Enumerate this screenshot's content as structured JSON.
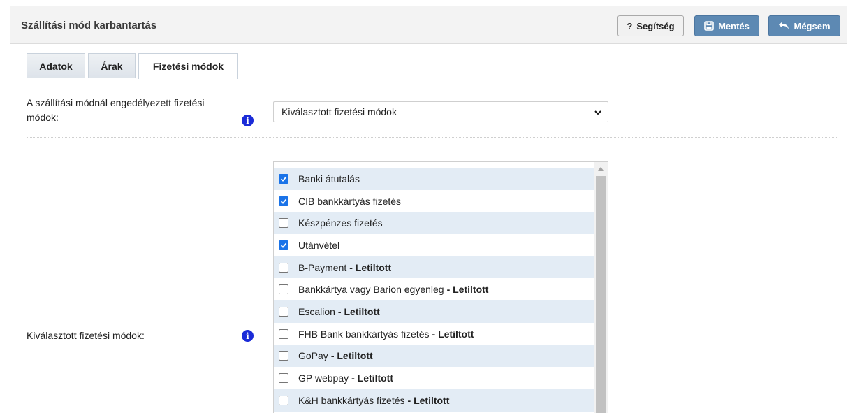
{
  "header": {
    "title": "Szállítási mód karbantartás",
    "help_label": "Segítség",
    "help_icon": "?",
    "save_label": "Mentés",
    "cancel_label": "Mégsem"
  },
  "tabs": [
    {
      "label": "Adatok",
      "active": false
    },
    {
      "label": "Árak",
      "active": false
    },
    {
      "label": "Fizetési módok",
      "active": true
    }
  ],
  "allowed_payment": {
    "label": "A szállítási módnál engedélyezett fizetési módok:",
    "selected": "Kiválasztott fizetési módok"
  },
  "selected_payment": {
    "label": "Kiválasztott fizetési módok:",
    "items": [
      {
        "name": "Banki átutalás",
        "checked": true,
        "status": ""
      },
      {
        "name": "CIB bankkártyás fizetés",
        "checked": true,
        "status": ""
      },
      {
        "name": "Készpénzes fizetés",
        "checked": false,
        "status": ""
      },
      {
        "name": "Utánvétel",
        "checked": true,
        "status": ""
      },
      {
        "name": "B-Payment",
        "checked": false,
        "status": "- Letiltott"
      },
      {
        "name": "Bankkártya vagy Barion egyenleg",
        "checked": false,
        "status": "- Letiltott"
      },
      {
        "name": "Escalion",
        "checked": false,
        "status": "- Letiltott"
      },
      {
        "name": "FHB Bank bankkártyás fizetés",
        "checked": false,
        "status": "- Letiltott"
      },
      {
        "name": "GoPay",
        "checked": false,
        "status": "- Letiltott"
      },
      {
        "name": "GP webpay",
        "checked": false,
        "status": "- Letiltott"
      },
      {
        "name": "K&H bankkártyás fizetés",
        "checked": false,
        "status": "- Letiltott"
      }
    ]
  },
  "colors": {
    "button_primary": "#5d89b3",
    "row_alt": "#e3ecf5",
    "checkbox_checked": "#1a73e8",
    "info_icon": "#1a2bd8"
  }
}
